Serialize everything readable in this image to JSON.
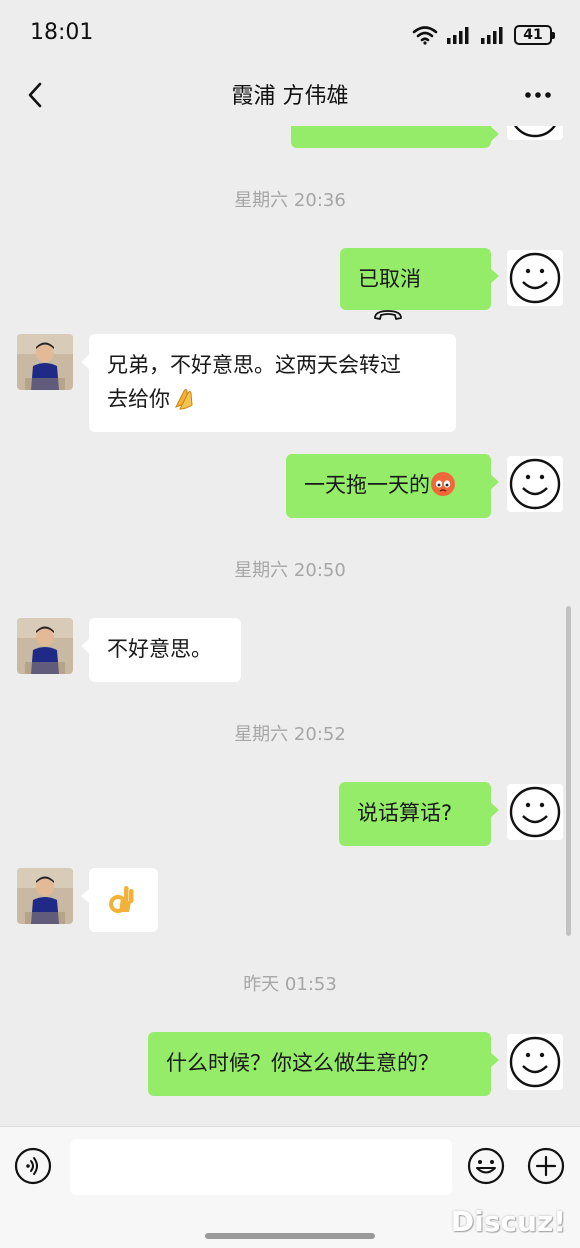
{
  "status_bar": {
    "time": "18:01",
    "battery": "41"
  },
  "nav": {
    "title": "霞浦 方伟雄"
  },
  "messages": {
    "time1": "星期六 20:36",
    "m1": "已取消",
    "m2_line1": "兄弟，不好意思。这两天会转过",
    "m2_line2": "去给你",
    "m3": "一天拖一天的",
    "time2": "星期六 20:50",
    "m4": "不好意思。",
    "time3": "星期六 20:52",
    "m5": "说话算话?",
    "time4": "昨天 01:53",
    "m7": "什么时候？你这么做生意的？"
  },
  "icons": {
    "back": "chevron-left-icon",
    "more": "more-dots-icon",
    "call": "phone-hangup-icon",
    "voice": "voice-icon",
    "emoji": "emoji-icon",
    "plus": "plus-icon",
    "pray": "pray-hands-emoji",
    "ok": "ok-hand-emoji",
    "angry": "angry-face-emoji"
  },
  "colors": {
    "my_bubble": "#95ec69",
    "their_bubble": "#ffffff",
    "background": "#ededed"
  },
  "watermark": "Discuz!"
}
